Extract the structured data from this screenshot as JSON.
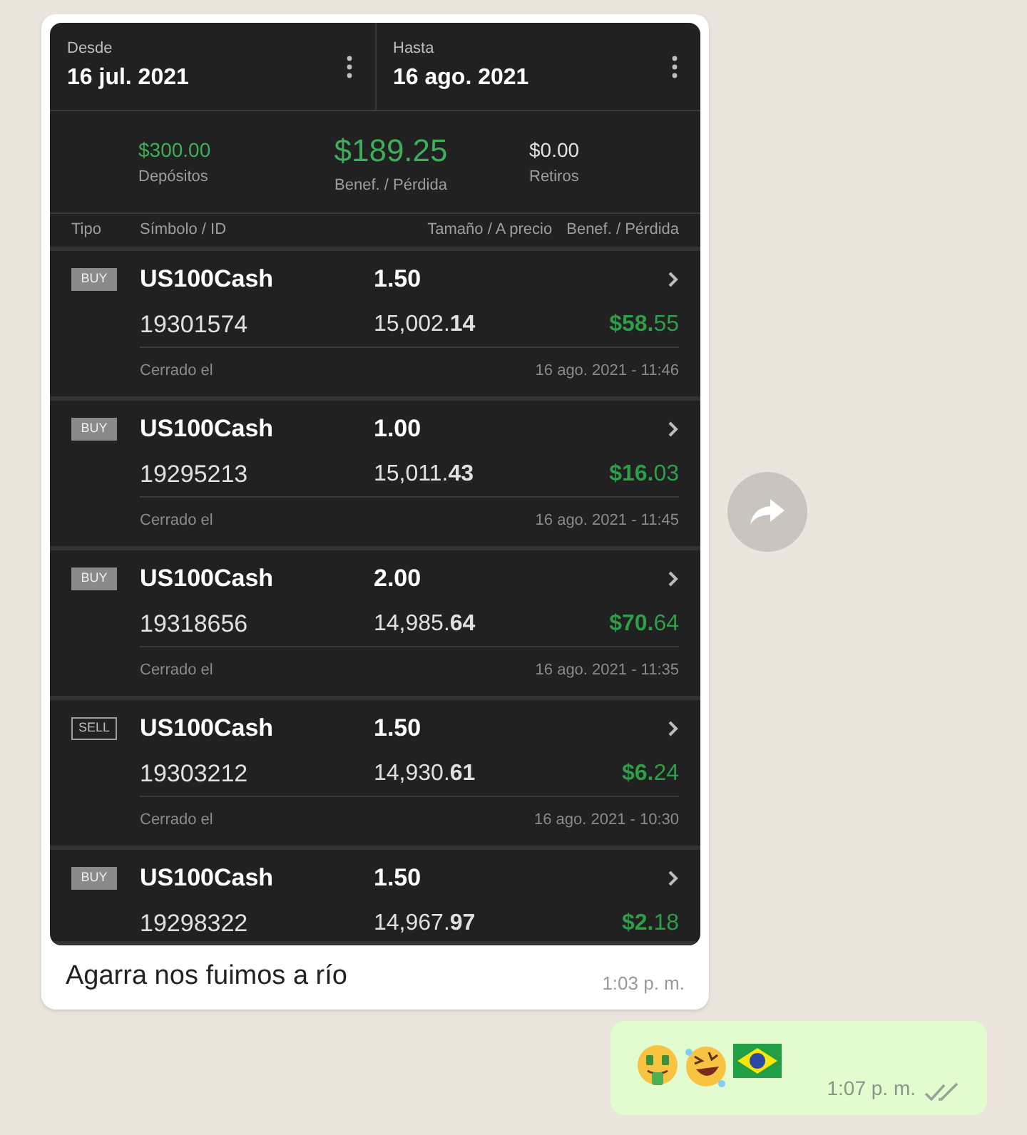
{
  "incoming": {
    "screenshot": {
      "range": [
        {
          "label": "Desde",
          "date": "16 jul. 2021"
        },
        {
          "label": "Hasta",
          "date": "16 ago. 2021"
        }
      ],
      "summary": [
        {
          "kind": "positive",
          "value": "$300.00",
          "label": "Depósitos"
        },
        {
          "kind": "total",
          "value": "$189.25",
          "label": "Benef. / Pérdida"
        },
        {
          "kind": "neutral",
          "value": "$0.00",
          "label": "Retiros"
        }
      ],
      "columns": [
        "Tipo",
        "Símbolo / ID",
        "Tamaño / A precio",
        "Benef. / Pérdida"
      ],
      "trades": [
        {
          "kind": "buy",
          "type": "BUY",
          "symbol": "US100Cash",
          "size": "1.50",
          "id": "19301574",
          "price": "15,002.**14**",
          "profit": "**$58.**55",
          "closed_label": "Cerrado el",
          "closed_at": "16 ago. 2021 - 11:46"
        },
        {
          "kind": "buy",
          "type": "BUY",
          "symbol": "US100Cash",
          "size": "1.00",
          "id": "19295213",
          "price": "15,011.**43**",
          "profit": "**$16.**03",
          "closed_label": "Cerrado el",
          "closed_at": "16 ago. 2021 - 11:45"
        },
        {
          "kind": "buy",
          "type": "BUY",
          "symbol": "US100Cash",
          "size": "2.00",
          "id": "19318656",
          "price": "14,985.**64**",
          "profit": "**$70.**64",
          "closed_label": "Cerrado el",
          "closed_at": "16 ago. 2021 - 11:35"
        },
        {
          "kind": "sell",
          "type": "SELL",
          "symbol": "US100Cash",
          "size": "1.50",
          "id": "19303212",
          "price": "14,930.**61**",
          "profit": "**$6.**24",
          "closed_label": "Cerrado el",
          "closed_at": "16 ago. 2021 - 10:30"
        },
        {
          "kind": "buy",
          "type": "BUY",
          "symbol": "US100Cash",
          "size": "1.50",
          "id": "19298322",
          "price": "14,967.**97**",
          "profit": "**$2.**18"
        }
      ]
    },
    "caption": "Agarra nos fuimos a río",
    "time": "1:03 p. m."
  },
  "outgoing": {
    "time": "1:07 p. m.",
    "read": false
  }
}
